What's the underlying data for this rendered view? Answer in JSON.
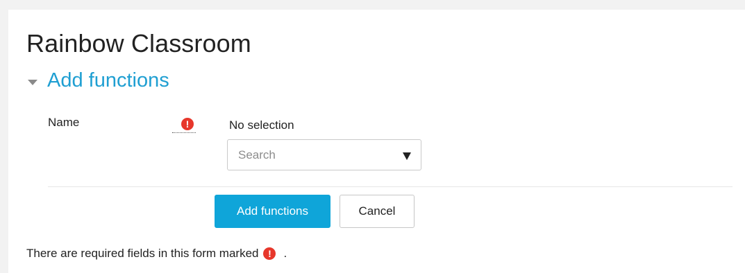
{
  "page": {
    "title": "Rainbow Classroom"
  },
  "section": {
    "title": "Add functions"
  },
  "form": {
    "name_label": "Name",
    "required_icon": "!",
    "selection_text": "No selection",
    "search_placeholder": "Search",
    "submit_label": "Add functions",
    "cancel_label": "Cancel"
  },
  "footer": {
    "note_text": "There are required fields in this form marked",
    "note_end": "."
  },
  "colors": {
    "accent": "#1f9fd2",
    "primary_button": "#0fa5d9",
    "required": "#e7372b"
  },
  "icons": {
    "section_toggle": "caret-down-icon",
    "required": "exclamation-circle-icon",
    "dropdown": "triangle-down-icon"
  }
}
